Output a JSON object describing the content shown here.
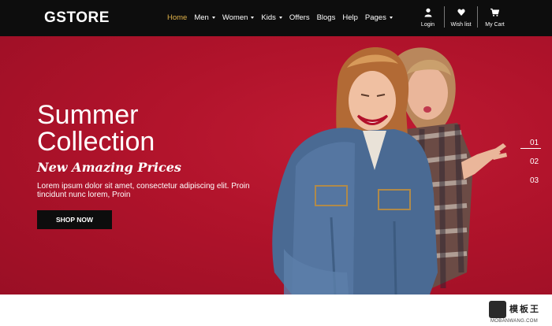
{
  "brand": "GSTORE",
  "nav": {
    "items": [
      {
        "label": "Home",
        "active": true,
        "dropdown": false
      },
      {
        "label": "Men",
        "active": false,
        "dropdown": true
      },
      {
        "label": "Women",
        "active": false,
        "dropdown": true
      },
      {
        "label": "Kids",
        "active": false,
        "dropdown": true
      },
      {
        "label": "Offers",
        "active": false,
        "dropdown": false
      },
      {
        "label": "Blogs",
        "active": false,
        "dropdown": false
      },
      {
        "label": "Help",
        "active": false,
        "dropdown": false
      },
      {
        "label": "Pages",
        "active": false,
        "dropdown": true
      }
    ],
    "actions": {
      "login": {
        "label": "Login",
        "icon": "user-icon"
      },
      "wishlist": {
        "label": "Wish list",
        "icon": "heart-icon"
      },
      "cart": {
        "label": "My Cart",
        "icon": "cart-icon"
      }
    }
  },
  "hero": {
    "title_line1": "Summer",
    "title_line2": "Collection",
    "subtitle": "New Amazing Prices",
    "text": "Lorem ipsum dolor sit amet, consectetur adipiscing elit. Proin tincidunt nunc lorem, Proin",
    "button": "SHOP NOW",
    "slides": [
      "01",
      "02",
      "03"
    ],
    "active_slide": "01"
  },
  "watermark": {
    "text": "模板王",
    "sub": "MOBANWANG.COM"
  },
  "colors": {
    "nav_bg": "#0d0d0d",
    "hero_bg": "#b5122c",
    "active_nav": "#e0b24a"
  }
}
